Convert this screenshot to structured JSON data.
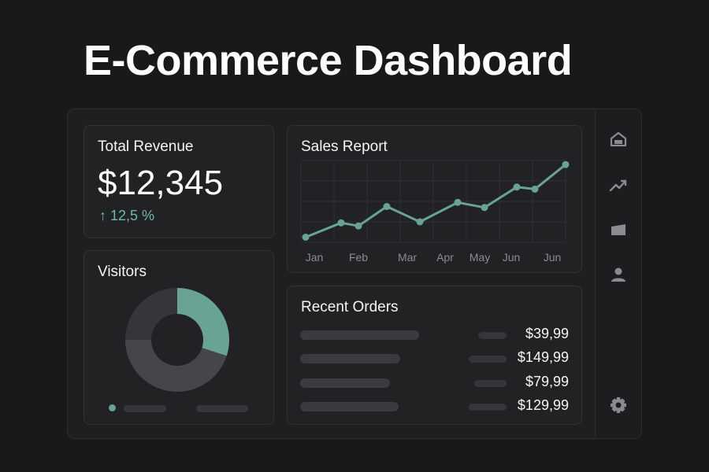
{
  "header": {
    "title": "E-Commerce Dashboard"
  },
  "revenue": {
    "title": "Total Revenue",
    "value": "$12,345",
    "change": "12,5 %",
    "change_direction": "up",
    "change_color": "#6fb9a5"
  },
  "visitors": {
    "title": "Visitors",
    "segments": [
      {
        "fraction": 0.3,
        "color": "#68a396"
      },
      {
        "fraction": 0.45,
        "color": "#45464b"
      },
      {
        "fraction": 0.25,
        "color": "#35363b"
      }
    ]
  },
  "sales": {
    "title": "Sales Report",
    "x_labels": [
      "Jan",
      "Feb",
      "Mar",
      "Apr",
      "May",
      "Jun",
      "Jun"
    ]
  },
  "chart_data": {
    "type": "line",
    "title": "Sales Report",
    "xlabel": "",
    "ylabel": "",
    "x_ticks": [
      "Jan",
      "Feb",
      "Mar",
      "Apr",
      "May",
      "Jun",
      "Jun"
    ],
    "grid": true,
    "line_color": "#68a396",
    "series": [
      {
        "values": [
          5,
          19,
          16,
          35,
          20,
          39,
          34,
          54,
          52,
          76
        ]
      }
    ],
    "ylim": [
      0,
      80
    ]
  },
  "orders": {
    "title": "Recent Orders",
    "rows": [
      {
        "amount": "$39,99"
      },
      {
        "amount": "$149,99"
      },
      {
        "amount": "$79,99"
      },
      {
        "amount": "$129,99"
      }
    ]
  },
  "rail": {
    "icons": [
      "home-icon",
      "trend-icon",
      "folder-icon",
      "user-icon",
      "gear-icon"
    ]
  },
  "colors": {
    "accent": "#68a396",
    "background": "#19191b",
    "card": "#222224"
  }
}
